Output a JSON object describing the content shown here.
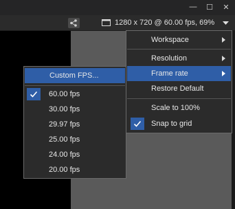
{
  "window": {
    "minimize": "—",
    "maximize": "☐",
    "close": "✕"
  },
  "status": {
    "text": "1280 x 720 @ 60.00 fps, 69%"
  },
  "main_menu": {
    "items": [
      {
        "label": "Workspace",
        "submenu": true
      },
      {
        "label": "Resolution",
        "submenu": true
      },
      {
        "label": "Frame rate",
        "submenu": true,
        "highlighted": true
      },
      {
        "label": "Restore Default"
      },
      {
        "label": "Scale to 100%"
      },
      {
        "label": "Snap to grid",
        "checked": true
      }
    ]
  },
  "frame_rate_menu": {
    "custom_label": "Custom FPS...",
    "options": [
      {
        "label": "60.00 fps",
        "checked": true
      },
      {
        "label": "30.00 fps"
      },
      {
        "label": "29.97 fps"
      },
      {
        "label": "25.00 fps"
      },
      {
        "label": "24.00 fps"
      },
      {
        "label": "20.00 fps"
      }
    ]
  },
  "colors": {
    "highlight": "#2f5ea7",
    "menu_bg": "#2b2b2b",
    "viewport": "#5a5a5a"
  }
}
